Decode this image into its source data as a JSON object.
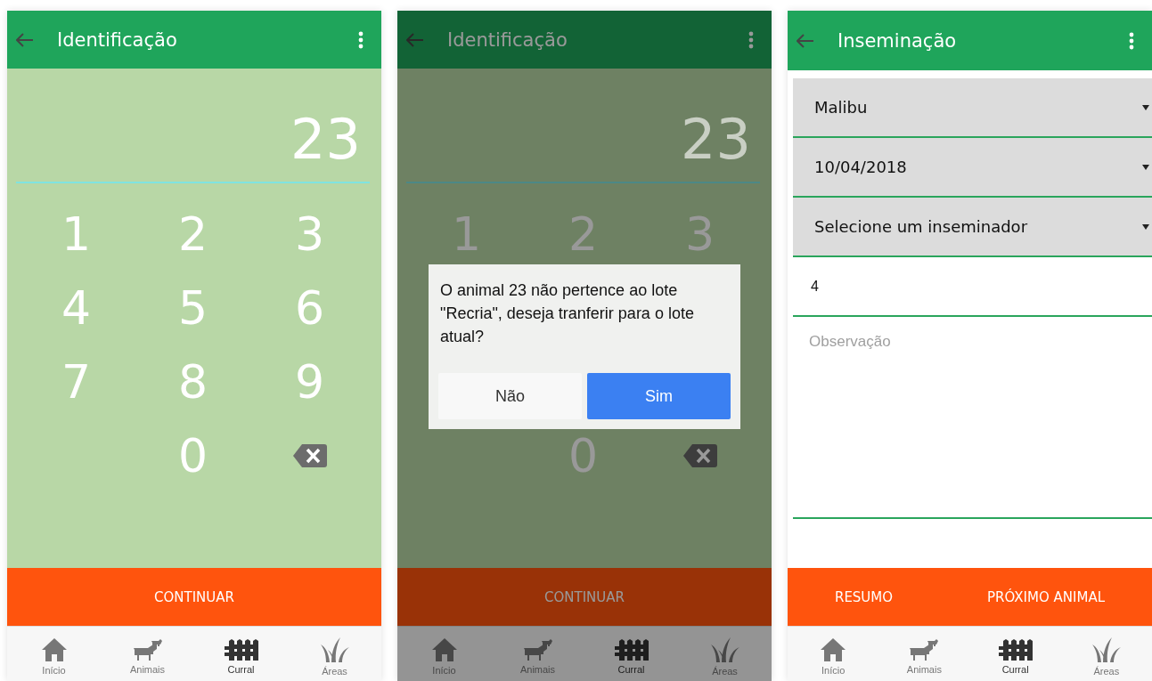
{
  "screens": [
    {
      "kind": "keypad",
      "title": "Identificação",
      "dimmed": false,
      "display": "23",
      "keys": [
        {
          "kind": "digit",
          "label": "1"
        },
        {
          "kind": "digit",
          "label": "2"
        },
        {
          "kind": "digit",
          "label": "3"
        },
        {
          "kind": "digit",
          "label": "4"
        },
        {
          "kind": "digit",
          "label": "5"
        },
        {
          "kind": "digit",
          "label": "6"
        },
        {
          "kind": "digit",
          "label": "7"
        },
        {
          "kind": "digit",
          "label": "8"
        },
        {
          "kind": "digit",
          "label": "9"
        },
        {
          "kind": "spacer"
        },
        {
          "kind": "digit",
          "label": "0"
        },
        {
          "kind": "backspace"
        }
      ],
      "actions": [
        "CONTINUAR"
      ],
      "nav": [
        {
          "kind": "home",
          "label": "Início",
          "selected": false
        },
        {
          "kind": "animals",
          "label": "Animais",
          "selected": false
        },
        {
          "kind": "fence",
          "label": "Curral",
          "selected": true
        },
        {
          "kind": "grass",
          "label": "Áreas",
          "selected": false
        }
      ]
    },
    {
      "kind": "keypad",
      "title": "Identificação",
      "dimmed": true,
      "display": "23",
      "keys": [
        {
          "kind": "digit",
          "label": "1"
        },
        {
          "kind": "digit",
          "label": "2"
        },
        {
          "kind": "digit",
          "label": "3"
        },
        {
          "kind": "spacer"
        },
        {
          "kind": "spacer"
        },
        {
          "kind": "spacer"
        },
        {
          "kind": "spacer"
        },
        {
          "kind": "spacer"
        },
        {
          "kind": "spacer"
        },
        {
          "kind": "spacer"
        },
        {
          "kind": "digit",
          "label": "0"
        },
        {
          "kind": "backspace"
        }
      ],
      "actions": [
        "CONTINUAR"
      ],
      "dialog": {
        "message": "O animal 23 não pertence ao lote \"Recria\", deseja tranferir para o lote atual?",
        "buttons": [
          {
            "kind": "secondary",
            "label": "Não"
          },
          {
            "kind": "primary",
            "label": "Sim"
          }
        ]
      },
      "nav": [
        {
          "kind": "home",
          "label": "Início",
          "selected": false
        },
        {
          "kind": "animals",
          "label": "Animais",
          "selected": false
        },
        {
          "kind": "fence",
          "label": "Curral",
          "selected": true
        },
        {
          "kind": "grass",
          "label": "Áreas",
          "selected": false
        }
      ]
    },
    {
      "kind": "form",
      "title": "Inseminação",
      "fields": [
        {
          "kind": "select",
          "value": "Malibu"
        },
        {
          "kind": "select",
          "value": "10/04/2018"
        },
        {
          "kind": "select",
          "value": "Selecione um inseminador"
        },
        {
          "kind": "input",
          "value": "4"
        },
        {
          "kind": "textarea",
          "placeholder": "Observação"
        }
      ],
      "actions": [
        "RESUMO",
        "PRÓXIMO ANIMAL"
      ],
      "nav": [
        {
          "kind": "home",
          "label": "Início",
          "selected": false
        },
        {
          "kind": "animals",
          "label": "Animais",
          "selected": false
        },
        {
          "kind": "fence",
          "label": "Curral",
          "selected": true
        },
        {
          "kind": "grass",
          "label": "Áreas",
          "selected": false
        }
      ]
    }
  ]
}
